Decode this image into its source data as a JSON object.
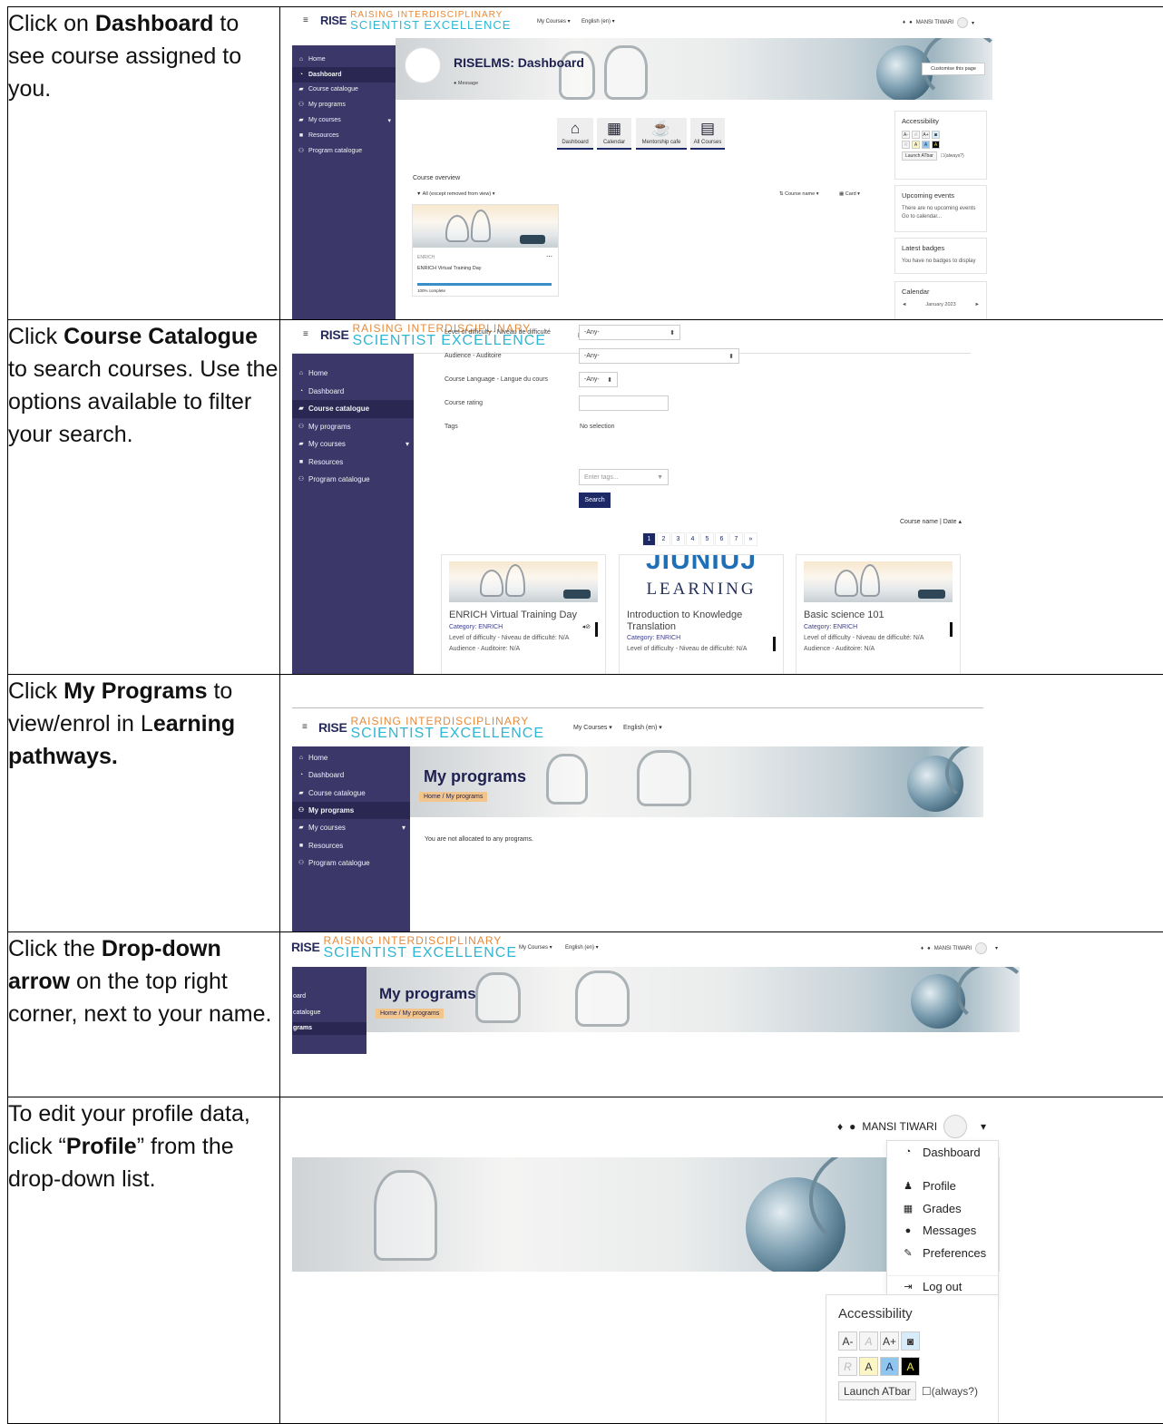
{
  "brand": {
    "mark": "RISE",
    "line1": "RAISING INTERDISCIPLINARY",
    "line2": "SCIENTIST EXCELLENCE"
  },
  "topnav": {
    "my_courses": "My Courses",
    "language": "English (en)",
    "user": "MANSI TIWARI"
  },
  "steps": [
    {
      "parts": [
        {
          "t": "Click on ",
          "b": false
        },
        {
          "t": "Dashboard",
          "b": true
        },
        {
          "t": " to see course assigned to you.",
          "b": false
        }
      ]
    },
    {
      "parts": [
        {
          "t": "Click ",
          "b": false
        },
        {
          "t": "Course Catalogue",
          "b": true
        },
        {
          "t": " to search courses. Use the options available to filter your search.",
          "b": false
        }
      ]
    },
    {
      "parts": [
        {
          "t": "Click ",
          "b": false
        },
        {
          "t": "My Programs",
          "b": true
        },
        {
          "t": " to view/enrol in L",
          "b": false
        },
        {
          "t": "earning pathways.",
          "b": true
        }
      ]
    },
    {
      "parts": [
        {
          "t": "Click the ",
          "b": false
        },
        {
          "t": "Drop-down arrow",
          "b": true
        },
        {
          "t": " on the top right corner, next to your name.",
          "b": false
        }
      ]
    },
    {
      "parts": [
        {
          "t": "To edit your profile data, click “",
          "b": false
        },
        {
          "t": "Profile",
          "b": true
        },
        {
          "t": "” from the drop-down list.",
          "b": false
        }
      ]
    }
  ],
  "sidebar": [
    {
      "label": "Home",
      "icon": "home-icon",
      "glyph": "⌂"
    },
    {
      "label": "Dashboard",
      "icon": "dashboard-icon",
      "glyph": "◔"
    },
    {
      "label": "Course catalogue",
      "icon": "graduation-cap-icon",
      "glyph": "▰"
    },
    {
      "label": "My programs",
      "icon": "users-icon",
      "glyph": "⚇"
    },
    {
      "label": "My courses",
      "icon": "graduation-cap-icon",
      "glyph": "▰"
    },
    {
      "label": "Resources",
      "icon": "square-icon",
      "glyph": "■"
    },
    {
      "label": "Program catalogue",
      "icon": "users-icon",
      "glyph": "⚇"
    }
  ],
  "shot1": {
    "page_title": "RISELMS: Dashboard",
    "message": "Message",
    "customise": "Customise this page",
    "quick": [
      "Dashboard",
      "Calendar",
      "Mentorship cafe",
      "All Courses"
    ],
    "course_overview": "Course overview",
    "filter": "All (except removed from view)",
    "sort": "Course name",
    "view": "Card",
    "course_cat": "ENRICH",
    "course_name": "ENRICH Virtual Training Day",
    "complete": "100% complete",
    "accessibility": "Accessibility",
    "launch": "Launch ATbar",
    "always": "(always?)",
    "upcoming": "Upcoming events",
    "upcoming_t1": "There are no upcoming events",
    "upcoming_t2": "Go to calendar...",
    "badges": "Latest badges",
    "badges_t": "You have no badges to display",
    "calendar": "Calendar",
    "month": "January 2023"
  },
  "shot2": {
    "filters": [
      {
        "label": "Level of difficulty - Niveau de difficulté",
        "value": "-Any-"
      },
      {
        "label": "Audience - Auditoire",
        "value": "-Any-"
      },
      {
        "label": "Course Language - Langue du cours",
        "value": "-Any-"
      },
      {
        "label": "Course rating",
        "value": ""
      },
      {
        "label": "Tags",
        "value": "No selection"
      }
    ],
    "tags_placeholder": "Enter tags...",
    "search": "Search",
    "sort": "Course name | Date",
    "pages": [
      "1",
      "2",
      "3",
      "4",
      "5",
      "6",
      "7",
      "»"
    ],
    "cards": [
      {
        "title": "ENRICH Virtual Training Day",
        "title2": "",
        "category": "Category: ENRICH",
        "level": "Level of difficulty - Niveau de difficulté: N/A",
        "audience": "Audience - Auditoire: N/A"
      },
      {
        "title": "Introduction to Knowledge",
        "title2": "Translation",
        "category": "Category: ENRICH",
        "level": "Level of difficulty - Niveau de difficulté: N/A",
        "audience": ""
      },
      {
        "title": "Basic science 101",
        "title2": "",
        "category": "Category: ENRICH",
        "level": "Level of difficulty - Niveau de difficulté: N/A",
        "audience": "Audience - Auditoire: N/A"
      }
    ],
    "card2_banner1": "JIUNIUJ",
    "card2_banner2": "LEARNING"
  },
  "shot3": {
    "title": "My programs",
    "crumb_home": "Home",
    "crumb_sep": "/",
    "crumb_current": "My programs",
    "message": "You are not allocated to any programs."
  },
  "shot4": {
    "title": "My programs",
    "crumb_home": "Home",
    "crumb_sep": "/",
    "crumb_current": "My programs",
    "side": [
      "oard",
      "catalogue",
      "grams"
    ]
  },
  "shot5": {
    "menu": [
      {
        "label": "Dashboard",
        "icon": "dashboard-icon",
        "glyph": "◔"
      },
      {
        "label": "Profile",
        "icon": "user-icon",
        "glyph": "♟"
      },
      {
        "label": "Grades",
        "icon": "table-icon",
        "glyph": "▦"
      },
      {
        "label": "Messages",
        "icon": "chat-icon",
        "glyph": "●"
      },
      {
        "label": "Preferences",
        "icon": "wrench-icon",
        "glyph": "✎"
      },
      {
        "label": "Log out",
        "icon": "sign-out-icon",
        "glyph": "⇥"
      }
    ],
    "accessibility": "Accessibility",
    "launch": "Launch ATbar",
    "always": "(always?)"
  },
  "a11y": {
    "sizes": [
      "A-",
      "A",
      "A+"
    ],
    "schemes": [
      "R",
      "A",
      "A",
      "A"
    ]
  }
}
